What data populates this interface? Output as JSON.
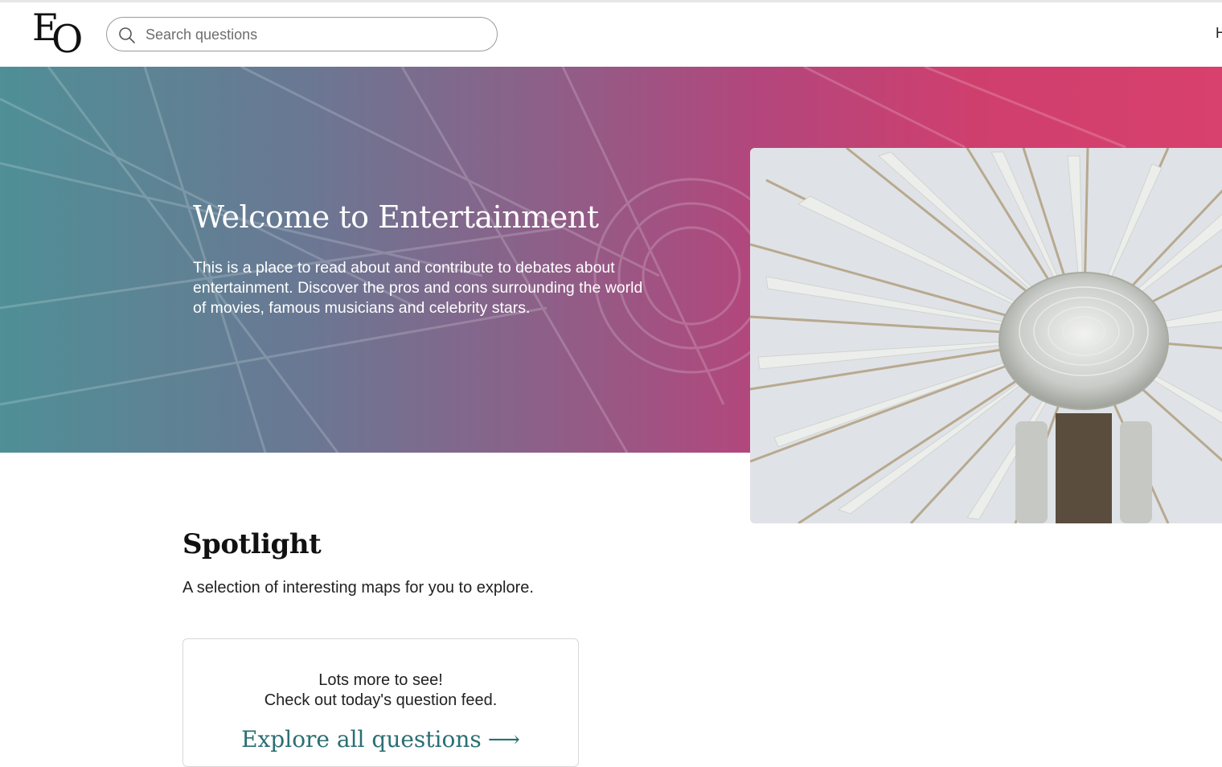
{
  "header": {
    "logo_letters": [
      "E",
      "O"
    ],
    "search": {
      "placeholder": "Search questions",
      "value": ""
    },
    "nav_cut_text": "H"
  },
  "hero": {
    "title": "Welcome to Entertainment",
    "description": "This is a place to read about and contribute to debates about entertainment. Discover the pros and cons surrounding the world of movies, famous musicians and celebrity stars.",
    "gradient_colors": [
      "#4f8f96",
      "#8e5f88",
      "#d8406d"
    ],
    "image_subject": "ferris-wheel-photo"
  },
  "spotlight": {
    "title": "Spotlight",
    "subtitle": "A selection of interesting maps for you to explore.",
    "card": {
      "line1": "Lots more to see!",
      "line2": "Check out today's question feed.",
      "link_label": "Explore all questions",
      "link_arrow": "⟶",
      "link_color": "#2a6f73"
    }
  }
}
